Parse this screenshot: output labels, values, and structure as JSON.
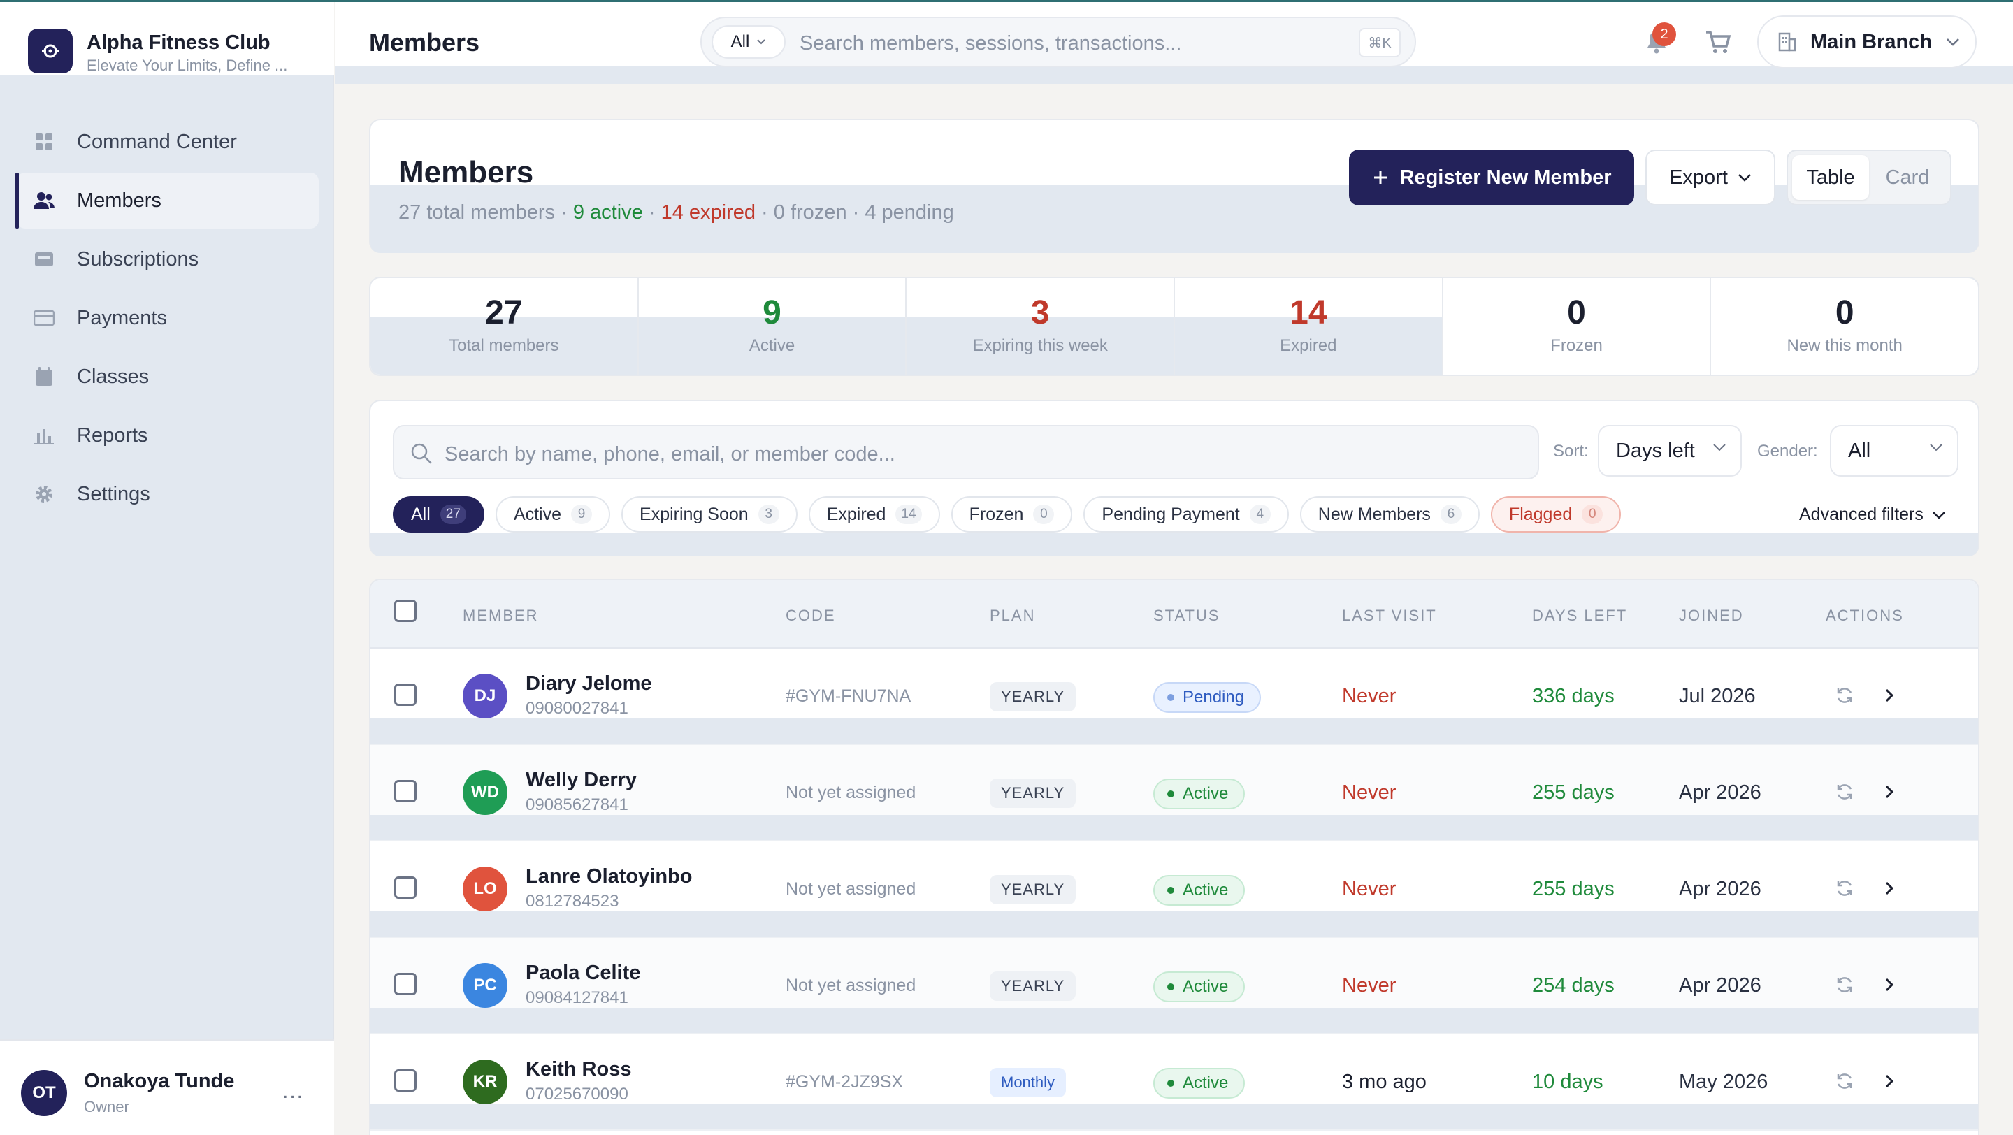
{
  "brand": {
    "name": "Alpha Fitness Club",
    "tagline": "Elevate Your Limits, Define ..."
  },
  "sidebar": {
    "items": [
      {
        "label": "Command Center",
        "icon": "grid-icon"
      },
      {
        "label": "Members",
        "icon": "users-icon",
        "active": true
      },
      {
        "label": "Subscriptions",
        "icon": "subscriptions-icon"
      },
      {
        "label": "Payments",
        "icon": "credit-card-icon"
      },
      {
        "label": "Classes",
        "icon": "calendar-icon"
      },
      {
        "label": "Reports",
        "icon": "bar-chart-icon"
      },
      {
        "label": "Settings",
        "icon": "gear-icon"
      }
    ]
  },
  "user": {
    "initials": "OT",
    "name": "Onakoya Tunde",
    "role": "Owner",
    "more": "..."
  },
  "header": {
    "title": "Members",
    "search_scope": "All",
    "search_placeholder": "Search members, sessions, transactions...",
    "shortcut": "⌘K",
    "notifications": "2",
    "branch": "Main Branch"
  },
  "members_card": {
    "title": "Members",
    "total": "27 total members",
    "active": "9 active",
    "expired": "14 expired",
    "frozen": "0 frozen",
    "pending": "4 pending",
    "register_label": "Register New Member",
    "export_label": "Export",
    "view_table": "Table",
    "view_card": "Card"
  },
  "stats": [
    {
      "value": "27",
      "label": "Total members",
      "color": "#1b1f2e"
    },
    {
      "value": "9",
      "label": "Active",
      "color": "#1f8a3b"
    },
    {
      "value": "3",
      "label": "Expiring this week",
      "color": "#c0392b"
    },
    {
      "value": "14",
      "label": "Expired",
      "color": "#c0392b"
    },
    {
      "value": "0",
      "label": "Frozen",
      "color": "#1b1f2e"
    },
    {
      "value": "0",
      "label": "New this month",
      "color": "#1b1f2e"
    }
  ],
  "filters": {
    "search_placeholder": "Search by name, phone, email, or member code...",
    "sort_label": "Sort:",
    "sort_value": "Days left",
    "gender_label": "Gender:",
    "gender_value": "All",
    "advanced": "Advanced filters",
    "chips": [
      {
        "label": "All",
        "count": "27"
      },
      {
        "label": "Active",
        "count": "9"
      },
      {
        "label": "Expiring Soon",
        "count": "3"
      },
      {
        "label": "Expired",
        "count": "14"
      },
      {
        "label": "Frozen",
        "count": "0"
      },
      {
        "label": "Pending Payment",
        "count": "4"
      },
      {
        "label": "New Members",
        "count": "6"
      },
      {
        "label": "Flagged",
        "count": "0"
      }
    ]
  },
  "table": {
    "columns": [
      "MEMBER",
      "CODE",
      "PLAN",
      "STATUS",
      "LAST VISIT",
      "DAYS LEFT",
      "JOINED",
      "ACTIONS"
    ],
    "rows": [
      {
        "initials": "DJ",
        "avatar_color": "#5b4fc4",
        "name": "Diary Jelome",
        "phone": "09080027841",
        "code": "#GYM-FNU7NA",
        "plan": "YEARLY",
        "status": "Pending",
        "last_visit": "Never",
        "days_left": "336 days",
        "joined": "Jul 2026"
      },
      {
        "initials": "WD",
        "avatar_color": "#1f9d55",
        "name": "Welly Derry",
        "phone": "09085627841",
        "code": "Not yet assigned",
        "plan": "YEARLY",
        "status": "Active",
        "last_visit": "Never",
        "days_left": "255 days",
        "joined": "Apr 2026"
      },
      {
        "initials": "LO",
        "avatar_color": "#e0533d",
        "name": "Lanre Olatoyinbo",
        "phone": "0812784523",
        "code": "Not yet assigned",
        "plan": "YEARLY",
        "status": "Active",
        "last_visit": "Never",
        "days_left": "255 days",
        "joined": "Apr 2026"
      },
      {
        "initials": "PC",
        "avatar_color": "#3b86e0",
        "name": "Paola Celite",
        "phone": "09084127841",
        "code": "Not yet assigned",
        "plan": "YEARLY",
        "status": "Active",
        "last_visit": "Never",
        "days_left": "254 days",
        "joined": "Apr 2026"
      },
      {
        "initials": "KR",
        "avatar_color": "#2e6b1f",
        "name": "Keith Ross",
        "phone": "07025670090",
        "code": "#GYM-2JZ9SX",
        "plan": "Monthly",
        "status": "Active",
        "last_visit": "3 mo ago",
        "days_left": "10 days",
        "joined": "May 2026"
      }
    ]
  }
}
